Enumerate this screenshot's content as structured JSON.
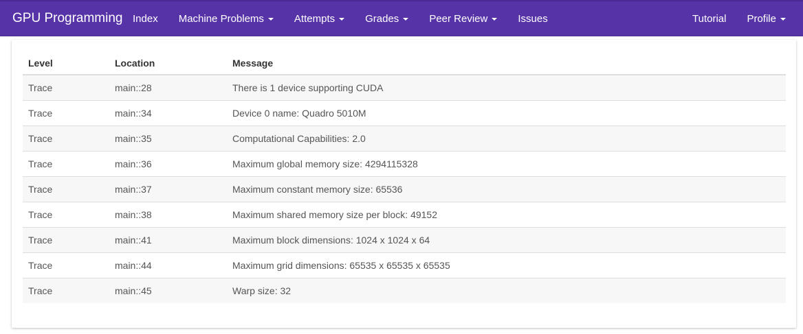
{
  "navbar": {
    "brand": "GPU Programming",
    "left_items": [
      {
        "label": "Index",
        "dropdown": false
      },
      {
        "label": "Machine Problems",
        "dropdown": true
      },
      {
        "label": "Attempts",
        "dropdown": true
      },
      {
        "label": "Grades",
        "dropdown": true
      },
      {
        "label": "Peer Review",
        "dropdown": true
      },
      {
        "label": "Issues",
        "dropdown": false
      }
    ],
    "right_items": [
      {
        "label": "Tutorial",
        "dropdown": false
      },
      {
        "label": "Profile",
        "dropdown": true
      }
    ],
    "background_color": "#5733a8"
  },
  "log_table": {
    "headers": {
      "level": "Level",
      "location": "Location",
      "message": "Message"
    },
    "rows": [
      {
        "level": "Trace",
        "location": "main::28",
        "message": "There is 1 device supporting CUDA"
      },
      {
        "level": "Trace",
        "location": "main::34",
        "message": "Device 0 name: Quadro 5010M"
      },
      {
        "level": "Trace",
        "location": "main::35",
        "message": "Computational Capabilities: 2.0"
      },
      {
        "level": "Trace",
        "location": "main::36",
        "message": "Maximum global memory size: 4294115328"
      },
      {
        "level": "Trace",
        "location": "main::37",
        "message": "Maximum constant memory size: 65536"
      },
      {
        "level": "Trace",
        "location": "main::38",
        "message": "Maximum shared memory size per block: 49152"
      },
      {
        "level": "Trace",
        "location": "main::41",
        "message": "Maximum block dimensions: 1024 x 1024 x 64"
      },
      {
        "level": "Trace",
        "location": "main::44",
        "message": "Maximum grid dimensions: 65535 x 65535 x 65535"
      },
      {
        "level": "Trace",
        "location": "main::45",
        "message": "Warp size: 32"
      }
    ]
  }
}
